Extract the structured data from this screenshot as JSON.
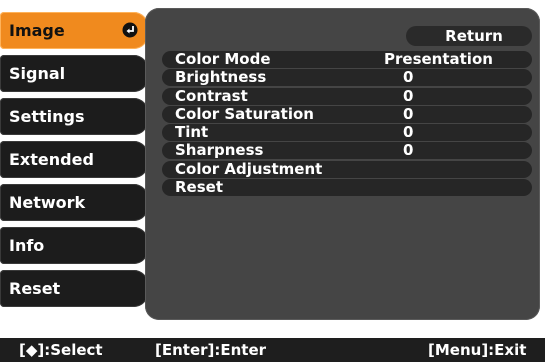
{
  "sidebar": {
    "items": [
      {
        "label": "Image",
        "active": true
      },
      {
        "label": "Signal"
      },
      {
        "label": "Settings"
      },
      {
        "label": "Extended"
      },
      {
        "label": "Network"
      },
      {
        "label": "Info"
      },
      {
        "label": "Reset"
      }
    ],
    "active_icon": "enter-icon"
  },
  "main": {
    "return_label": "Return",
    "rows": [
      {
        "label": "Color Mode",
        "value": "Presentation"
      },
      {
        "label": "Brightness",
        "value": "0"
      },
      {
        "label": "Contrast",
        "value": "0"
      },
      {
        "label": "Color Saturation",
        "value": "0"
      },
      {
        "label": "Tint",
        "value": "0"
      },
      {
        "label": "Sharpness",
        "value": "0"
      },
      {
        "label": "Color Adjustment",
        "value": ""
      },
      {
        "label": "Reset",
        "value": ""
      }
    ]
  },
  "footer": {
    "select_hint": "[◆]:Select",
    "enter_hint": "[Enter]:Enter",
    "exit_hint": "[Menu]:Exit"
  },
  "colors": {
    "accent": "#f08a1e",
    "menu_background": "#454545",
    "row_background": "#262626",
    "sidebar_item": "#1c1c1c"
  }
}
